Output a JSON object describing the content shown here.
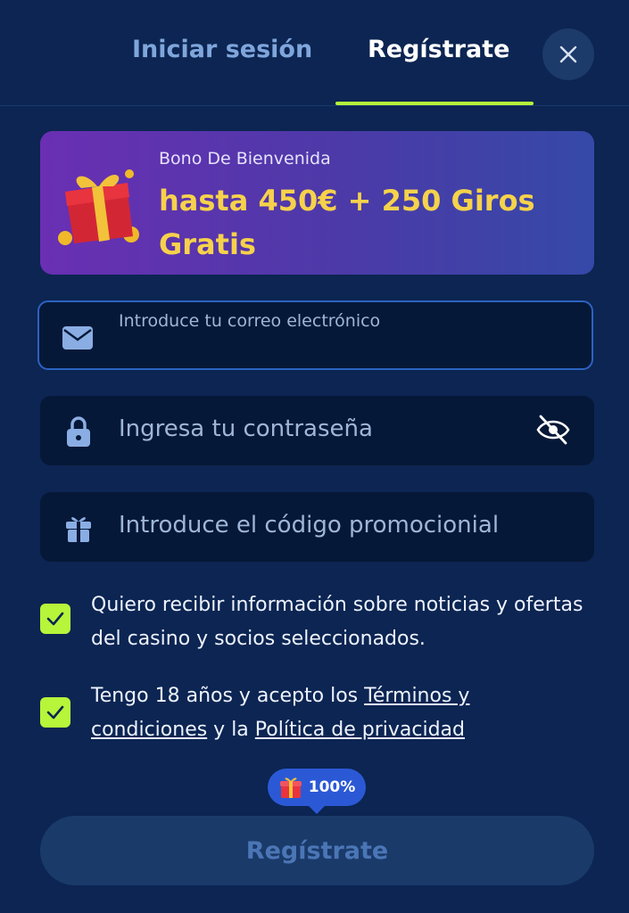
{
  "tabs": {
    "login_label": "Iniciar sesión",
    "register_label": "Regístrate",
    "active": "register"
  },
  "close_icon": "close-icon",
  "banner": {
    "subtitle": "Bono De Bienvenida",
    "title": "hasta 450€ + 250 Giros Gratis",
    "icon": "gift-box-icon"
  },
  "form": {
    "email": {
      "label": "Introduce tu correo electrónico",
      "value": "",
      "icon": "mail-icon"
    },
    "password": {
      "placeholder": "Ingresa tu contraseña",
      "icon": "lock-icon",
      "toggle_icon": "eye-off-icon"
    },
    "promo": {
      "placeholder": "Introduce el código promocionial",
      "icon": "gift-icon"
    }
  },
  "checkboxes": [
    {
      "checked": true,
      "text": "Quiero recibir información sobre noticias y ofertas del casino y socios seleccionados."
    },
    {
      "checked": true,
      "text_prefix": "Tengo 18 años y acepto los ",
      "terms_link": "Términos y condiciones",
      "text_middle": " y la ",
      "privacy_link": "Política de privacidad"
    }
  ],
  "progress_badge": {
    "text": "100%",
    "progress_percent": 100
  },
  "submit_label": "Regístrate",
  "colors": {
    "background": "#0c2552",
    "accent": "#b6f53a",
    "banner_gold": "#f6d24b",
    "badge_blue": "#2b59d6"
  }
}
